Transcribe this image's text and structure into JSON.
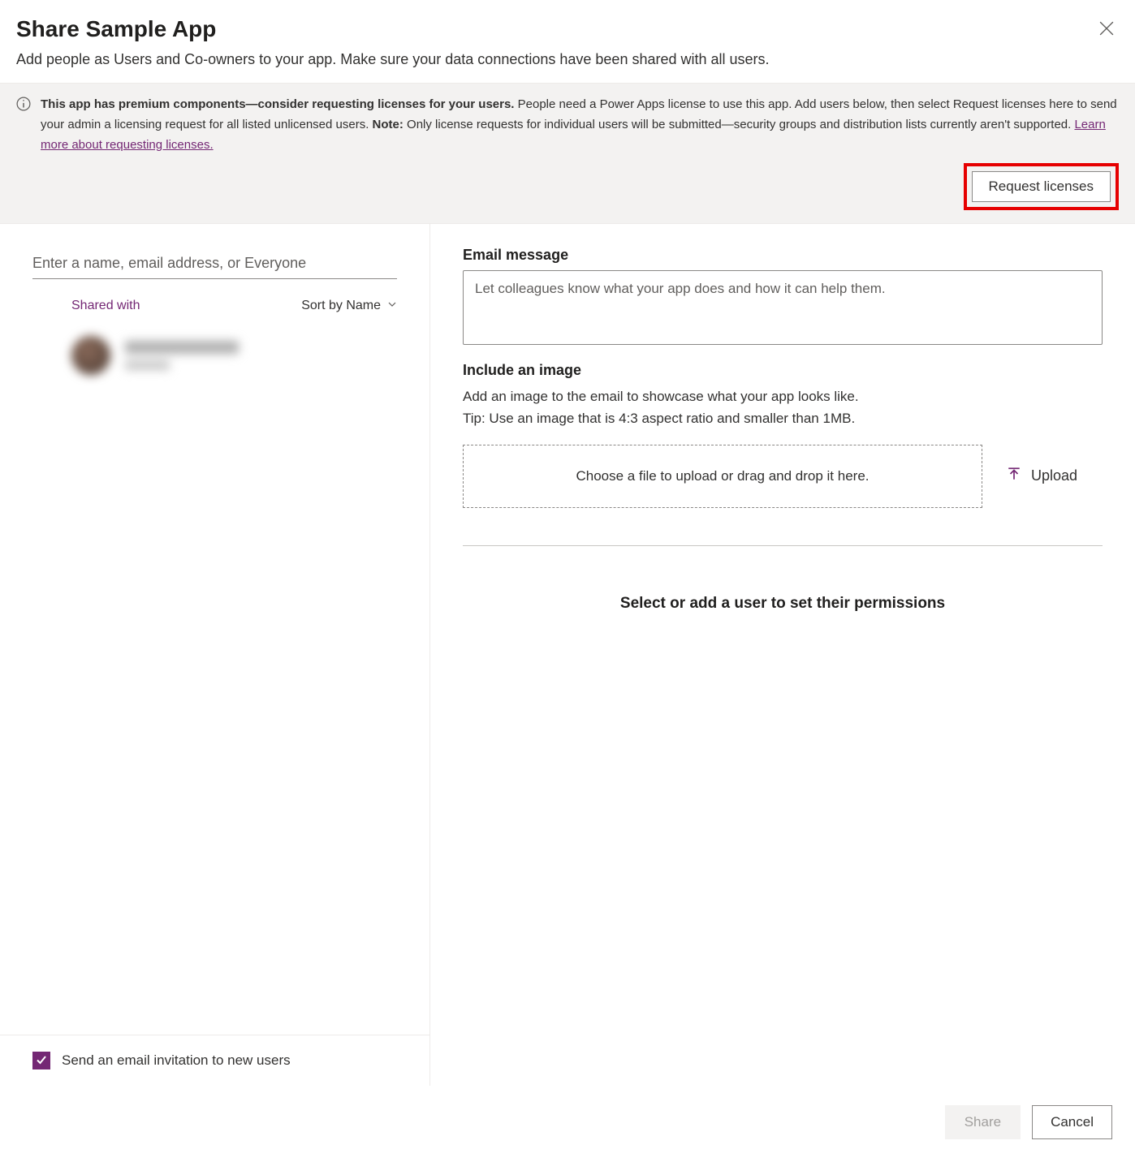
{
  "header": {
    "title": "Share Sample App"
  },
  "subtitle": "Add people as Users and Co-owners to your app. Make sure your data connections have been shared with all users.",
  "banner": {
    "bold_lead": "This app has premium components—consider requesting licenses for your users.",
    "text1": " People need a Power Apps license to use this app. Add users below, then select Request licenses here to send your admin a licensing request for all listed unlicensed users. ",
    "note_label": "Note:",
    "text2": " Only license requests for individual users will be submitted—security groups and distribution lists currently aren't supported. ",
    "link": "Learn more about requesting licenses.",
    "button": "Request licenses"
  },
  "left": {
    "search_placeholder": "Enter a name, email address, or Everyone",
    "shared_with": "Shared with",
    "sort_by": "Sort by Name"
  },
  "right": {
    "email_label": "Email message",
    "email_placeholder": "Let colleagues know what your app does and how it can help them.",
    "image_label": "Include an image",
    "image_help1": "Add an image to the email to showcase what your app looks like.",
    "image_help2": "Tip: Use an image that is 4:3 aspect ratio and smaller than 1MB.",
    "dropzone": "Choose a file to upload or drag and drop it here.",
    "upload": "Upload",
    "permissions_prompt": "Select or add a user to set their permissions"
  },
  "checkbox": {
    "label": "Send an email invitation to new users"
  },
  "footer": {
    "share": "Share",
    "cancel": "Cancel"
  }
}
